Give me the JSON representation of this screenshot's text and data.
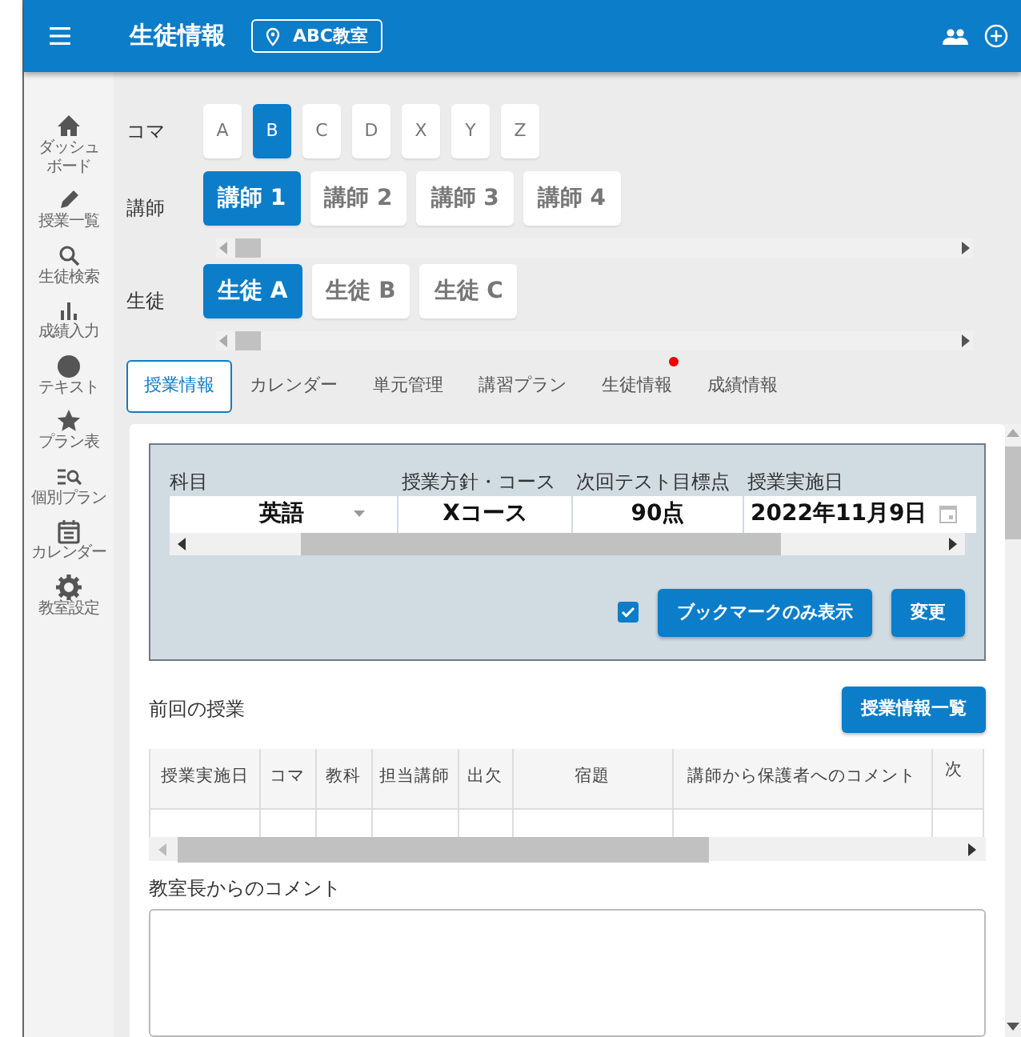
{
  "header": {
    "title": "生徒情報",
    "location": "ABC教室"
  },
  "sidebar": {
    "items": [
      {
        "lines": [
          "ダッシュ",
          "ボード"
        ]
      },
      {
        "lines": [
          "授業一覧"
        ]
      },
      {
        "lines": [
          "生徒検索"
        ]
      },
      {
        "lines": [
          "成績入力"
        ]
      },
      {
        "lines": [
          "テキスト"
        ]
      },
      {
        "lines": [
          "プラン表"
        ]
      },
      {
        "lines": [
          "個別プラン"
        ]
      },
      {
        "lines": [
          "カレンダー"
        ]
      },
      {
        "lines": [
          "教室設定"
        ]
      }
    ]
  },
  "koma": {
    "label": "コマ",
    "options": [
      {
        "label": "A",
        "selected": false
      },
      {
        "label": "B",
        "selected": true
      },
      {
        "label": "C",
        "selected": false
      },
      {
        "label": "D",
        "selected": false
      },
      {
        "label": "X",
        "selected": false
      },
      {
        "label": "Y",
        "selected": false
      },
      {
        "label": "Z",
        "selected": false
      }
    ]
  },
  "teachers": {
    "label": "講師",
    "options": [
      {
        "label": "講師 1",
        "selected": true
      },
      {
        "label": "講師 2",
        "selected": false
      },
      {
        "label": "講師 3",
        "selected": false
      },
      {
        "label": "講師 4",
        "selected": false
      }
    ]
  },
  "students": {
    "label": "生徒",
    "options": [
      {
        "label": "生徒 A",
        "selected": true
      },
      {
        "label": "生徒 B",
        "selected": false
      },
      {
        "label": "生徒 C",
        "selected": false
      }
    ]
  },
  "tabs": [
    {
      "label": "授業情報",
      "selected": true,
      "notification": false
    },
    {
      "label": "カレンダー",
      "selected": false,
      "notification": false
    },
    {
      "label": "単元管理",
      "selected": false,
      "notification": false
    },
    {
      "label": "講習プラン",
      "selected": false,
      "notification": false
    },
    {
      "label": "生徒情報",
      "selected": false,
      "notification": true
    },
    {
      "label": "成績情報",
      "selected": false,
      "notification": false
    }
  ],
  "filters": {
    "fields": [
      {
        "kind": "select",
        "label": "科目",
        "value": "英語"
      },
      {
        "kind": "text",
        "label": "授業方針・コース",
        "value": "Xコース"
      },
      {
        "kind": "text",
        "label": "次回テスト目標点",
        "value": "90点"
      },
      {
        "kind": "date",
        "label": "授業実施日",
        "value": "2022年11月9日"
      }
    ],
    "bookmark_only": {
      "checked": true,
      "label": "ブックマークのみ表示"
    },
    "apply_button": "変更"
  },
  "previous_lesson": {
    "title": "前回の授業",
    "list_button": "授業情報一覧",
    "table": {
      "columns": [
        "授業実施日",
        "コマ",
        "教科",
        "担当講師",
        "出欠",
        "宿題",
        "講師から保護者へのコメント",
        "次"
      ]
    }
  },
  "manager_comment": {
    "label": "教室長からのコメント"
  }
}
